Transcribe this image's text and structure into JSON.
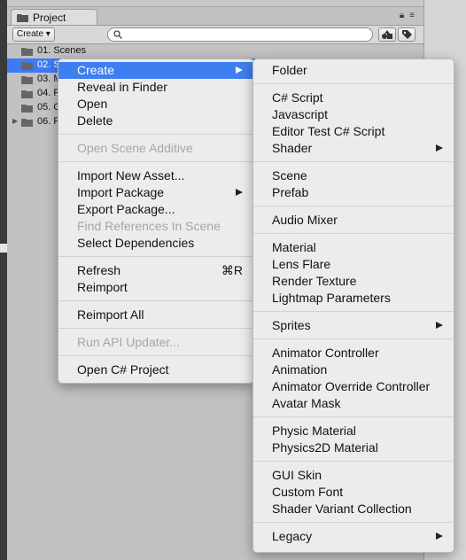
{
  "window": {
    "tab_title": "Project"
  },
  "toolbar": {
    "create_label": "Create ▾"
  },
  "tree": [
    {
      "name": "01. Scenes",
      "selected": false,
      "expander": false
    },
    {
      "name": "02. S",
      "selected": true,
      "expander": false
    },
    {
      "name": "03. M",
      "selected": false,
      "expander": false
    },
    {
      "name": "04. P",
      "selected": false,
      "expander": false
    },
    {
      "name": "05. O",
      "selected": false,
      "expander": false
    },
    {
      "name": "06. P",
      "selected": false,
      "expander": true
    }
  ],
  "context_menu": {
    "items": [
      {
        "label": "Create",
        "highlighted": true,
        "submenu": true
      },
      {
        "label": "Reveal in Finder"
      },
      {
        "label": "Open"
      },
      {
        "label": "Delete"
      },
      {
        "label": "Open Scene Additive",
        "disabled": true
      },
      {
        "label": "Import New Asset..."
      },
      {
        "label": "Import Package",
        "submenu": true
      },
      {
        "label": "Export Package..."
      },
      {
        "label": "Find References In Scene",
        "disabled": true
      },
      {
        "label": "Select Dependencies"
      },
      {
        "label": "Refresh",
        "shortcut": "⌘R"
      },
      {
        "label": "Reimport"
      },
      {
        "label": "Reimport All"
      },
      {
        "label": "Run API Updater...",
        "disabled": true
      },
      {
        "label": "Open C# Project"
      }
    ]
  },
  "create_submenu": {
    "items": [
      {
        "label": "Folder"
      },
      {
        "label": "C# Script"
      },
      {
        "label": "Javascript"
      },
      {
        "label": "Editor Test C# Script"
      },
      {
        "label": "Shader",
        "submenu": true
      },
      {
        "label": "Scene"
      },
      {
        "label": "Prefab"
      },
      {
        "label": "Audio Mixer"
      },
      {
        "label": "Material"
      },
      {
        "label": "Lens Flare"
      },
      {
        "label": "Render Texture"
      },
      {
        "label": "Lightmap Parameters"
      },
      {
        "label": "Sprites",
        "submenu": true
      },
      {
        "label": "Animator Controller"
      },
      {
        "label": "Animation"
      },
      {
        "label": "Animator Override Controller"
      },
      {
        "label": "Avatar Mask"
      },
      {
        "label": "Physic Material"
      },
      {
        "label": "Physics2D Material"
      },
      {
        "label": "GUI Skin"
      },
      {
        "label": "Custom Font"
      },
      {
        "label": "Shader Variant Collection"
      },
      {
        "label": "Legacy",
        "submenu": true
      }
    ]
  },
  "colors": {
    "highlight": "#3e7ef0",
    "selection": "#3d7af4",
    "menu_bg": "#ececec",
    "panel_bg": "#c2c2c2"
  }
}
